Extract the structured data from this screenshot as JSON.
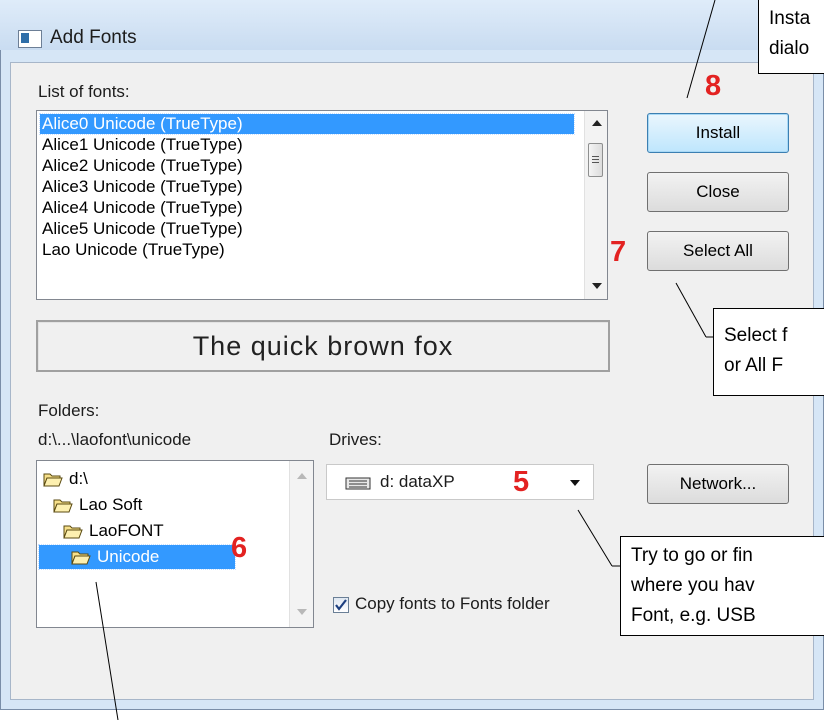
{
  "window": {
    "title": "Add Fonts"
  },
  "fonts_section": {
    "label": "List of fonts:",
    "items": [
      "Alice0 Unicode (TrueType)",
      "Alice1 Unicode (TrueType)",
      "Alice2 Unicode (TrueType)",
      "Alice3 Unicode (TrueType)",
      "Alice4 Unicode (TrueType)",
      "Alice5 Unicode (TrueType)",
      "Lao Unicode (TrueType)"
    ],
    "selected_index": 0
  },
  "preview": {
    "text": "The quick brown fox"
  },
  "folders": {
    "label": "Folders:",
    "path": "d:\\...\\laofont\\unicode",
    "items": [
      "d:\\",
      "Lao Soft",
      "LaoFONT",
      "Unicode"
    ],
    "selected_index": 3
  },
  "drives": {
    "label": "Drives:",
    "value": "d: dataXP"
  },
  "buttons": {
    "install": "Install",
    "close": "Close",
    "select_all": "Select All",
    "network": "Network..."
  },
  "copy_option": {
    "label": "Copy fonts to Fonts folder",
    "checked": true
  },
  "annotations": {
    "steps": [
      "8",
      "7",
      "5",
      "6"
    ],
    "callout_install": [
      "Insta",
      "dialo"
    ],
    "callout_select": [
      "Select f",
      "or All F"
    ],
    "callout_drive": [
      "Try to go or fin",
      "where you hav",
      "Font, e.g. USB"
    ]
  },
  "colors": {
    "selection": "#3399ff",
    "step_number": "#e32221",
    "window_frame": "#d6e6f6"
  }
}
